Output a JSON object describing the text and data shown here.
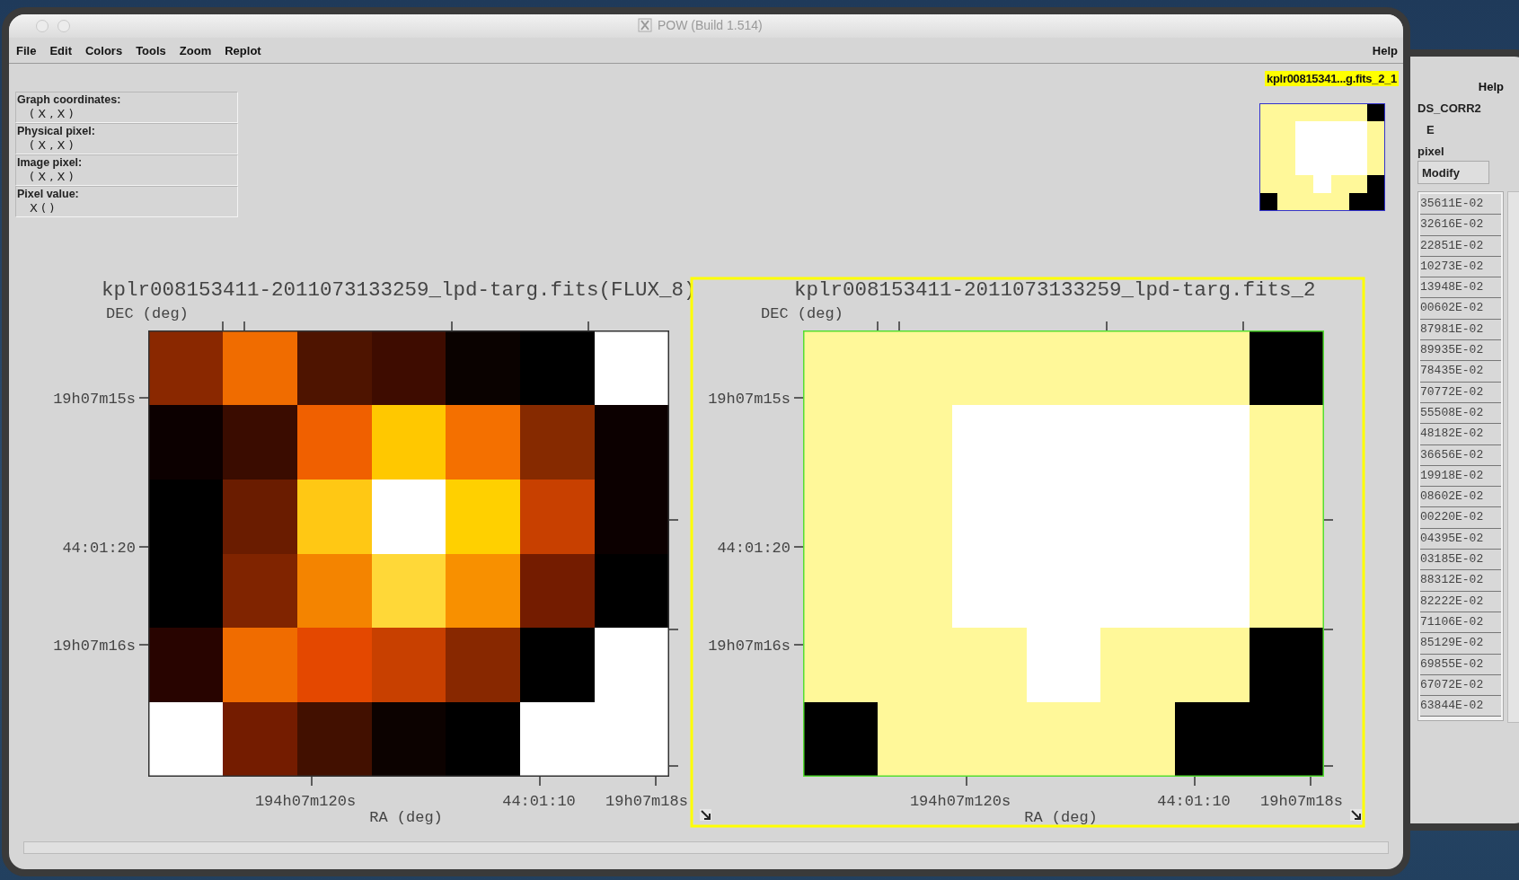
{
  "window": {
    "title": "POW (Build 1.514)"
  },
  "menu": [
    {
      "label": "File"
    },
    {
      "label": "Edit"
    },
    {
      "label": "Colors"
    },
    {
      "label": "Tools"
    },
    {
      "label": "Zoom"
    },
    {
      "label": "Replot"
    }
  ],
  "help_menu": "Help",
  "info_panel": [
    {
      "label": "Graph coordinates:",
      "value": "( X , X )"
    },
    {
      "label": "Physical pixel:",
      "value": "( X , X )"
    },
    {
      "label": "Image pixel:",
      "value": "( X , X )"
    },
    {
      "label": "Pixel value:",
      "value": "X ( )"
    }
  ],
  "current_graph_label": "kplr00815341...g.fits_2_1",
  "thumbnail": {
    "pixels": [
      [
        {
          "color": "#fff899"
        },
        {
          "color": "#fff899"
        },
        {
          "color": "#fff899"
        },
        {
          "color": "#fff899"
        },
        {
          "color": "#fff899"
        },
        {
          "color": "#fff899"
        },
        {
          "color": "#000000"
        }
      ],
      [
        {
          "color": "#fff899"
        },
        {
          "color": "#fff899"
        },
        {
          "color": "#ffffff"
        },
        {
          "color": "#ffffff"
        },
        {
          "color": "#ffffff"
        },
        {
          "color": "#ffffff"
        },
        {
          "color": "#fff899"
        }
      ],
      [
        {
          "color": "#fff899"
        },
        {
          "color": "#fff899"
        },
        {
          "color": "#ffffff"
        },
        {
          "color": "#ffffff"
        },
        {
          "color": "#ffffff"
        },
        {
          "color": "#ffffff"
        },
        {
          "color": "#fff899"
        }
      ],
      [
        {
          "color": "#fff899"
        },
        {
          "color": "#fff899"
        },
        {
          "color": "#ffffff"
        },
        {
          "color": "#ffffff"
        },
        {
          "color": "#ffffff"
        },
        {
          "color": "#ffffff"
        },
        {
          "color": "#fff899"
        }
      ],
      [
        {
          "color": "#fff899"
        },
        {
          "color": "#fff899"
        },
        {
          "color": "#fff899"
        },
        {
          "color": "#ffffff"
        },
        {
          "color": "#fff899"
        },
        {
          "color": "#fff899"
        },
        {
          "color": "#000000"
        }
      ],
      [
        {
          "color": "#000000"
        },
        {
          "color": "#fff899"
        },
        {
          "color": "#fff899"
        },
        {
          "color": "#fff899"
        },
        {
          "color": "#fff899"
        },
        {
          "color": "#000000"
        },
        {
          "color": "#000000"
        }
      ]
    ]
  },
  "plots": [
    {
      "title": "kplr008153411-2011073133259_lpd-targ.fits(FLUX_8)",
      "selected": false,
      "y_axis_label": "DEC (deg)",
      "x_axis_label": "RA (deg)",
      "y_ticks": [
        "19h07m15s",
        "44:01:20",
        "19h07m16s"
      ],
      "x_ticks": [
        "194h07m120s",
        "44:01:10",
        "19h07m18s"
      ],
      "pixels": [
        [
          {
            "color": "#8a2800"
          },
          {
            "color": "#f06c00"
          },
          {
            "color": "#4e1400"
          },
          {
            "color": "#3e0c00"
          },
          {
            "color": "#0a0200"
          },
          {
            "color": "#000000"
          },
          {
            "color": "#ffffff"
          }
        ],
        [
          {
            "color": "#0c0000"
          },
          {
            "color": "#3a0c00"
          },
          {
            "color": "#f06000"
          },
          {
            "color": "#ffc800"
          },
          {
            "color": "#f47000"
          },
          {
            "color": "#862a00"
          },
          {
            "color": "#0c0000"
          }
        ],
        [
          {
            "color": "#000000"
          },
          {
            "color": "#6a1c00"
          },
          {
            "color": "#ffc814"
          },
          {
            "color": "#ffffff"
          },
          {
            "color": "#ffd000"
          },
          {
            "color": "#c84000"
          },
          {
            "color": "#0c0000"
          }
        ],
        [
          {
            "color": "#000000"
          },
          {
            "color": "#802400"
          },
          {
            "color": "#f48400"
          },
          {
            "color": "#ffd838"
          },
          {
            "color": "#f89000"
          },
          {
            "color": "#741c00"
          },
          {
            "color": "#000000"
          }
        ],
        [
          {
            "color": "#280400"
          },
          {
            "color": "#f06c00"
          },
          {
            "color": "#e44800"
          },
          {
            "color": "#c84000"
          },
          {
            "color": "#882800"
          },
          {
            "color": "#000000"
          },
          {
            "color": "#ffffff"
          }
        ],
        [
          {
            "color": "#ffffff"
          },
          {
            "color": "#741c00"
          },
          {
            "color": "#421000"
          },
          {
            "color": "#0c0200"
          },
          {
            "color": "#000000"
          },
          {
            "color": "#ffffff"
          },
          {
            "color": "#ffffff"
          }
        ]
      ]
    },
    {
      "title": "kplr008153411-2011073133259_lpd-targ.fits_2",
      "selected": true,
      "y_axis_label": "DEC (deg)",
      "x_axis_label": "RA (deg)",
      "y_ticks": [
        "19h07m15s",
        "44:01:20",
        "19h07m16s"
      ],
      "x_ticks": [
        "194h07m120s",
        "44:01:10",
        "19h07m18s"
      ],
      "pixels": [
        [
          {
            "color": "#fff899"
          },
          {
            "color": "#fff899"
          },
          {
            "color": "#fff899"
          },
          {
            "color": "#fff899"
          },
          {
            "color": "#fff899"
          },
          {
            "color": "#fff899"
          },
          {
            "color": "#000000"
          }
        ],
        [
          {
            "color": "#fff899"
          },
          {
            "color": "#fff899"
          },
          {
            "color": "#ffffff"
          },
          {
            "color": "#ffffff"
          },
          {
            "color": "#ffffff"
          },
          {
            "color": "#ffffff"
          },
          {
            "color": "#fff899"
          }
        ],
        [
          {
            "color": "#fff899"
          },
          {
            "color": "#fff899"
          },
          {
            "color": "#ffffff"
          },
          {
            "color": "#ffffff"
          },
          {
            "color": "#ffffff"
          },
          {
            "color": "#ffffff"
          },
          {
            "color": "#fff899"
          }
        ],
        [
          {
            "color": "#fff899"
          },
          {
            "color": "#fff899"
          },
          {
            "color": "#ffffff"
          },
          {
            "color": "#ffffff"
          },
          {
            "color": "#ffffff"
          },
          {
            "color": "#ffffff"
          },
          {
            "color": "#fff899"
          }
        ],
        [
          {
            "color": "#fff899"
          },
          {
            "color": "#fff899"
          },
          {
            "color": "#fff899"
          },
          {
            "color": "#ffffff"
          },
          {
            "color": "#fff899"
          },
          {
            "color": "#fff899"
          },
          {
            "color": "#000000"
          }
        ],
        [
          {
            "color": "#000000"
          },
          {
            "color": "#fff899"
          },
          {
            "color": "#fff899"
          },
          {
            "color": "#fff899"
          },
          {
            "color": "#fff899"
          },
          {
            "color": "#000000"
          },
          {
            "color": "#000000"
          }
        ]
      ]
    }
  ],
  "back_window": {
    "help_menu": "Help",
    "column_name": "DS_CORR2",
    "line_2": "E",
    "line_3": "pixel",
    "button": "Modify",
    "values": [
      "35611E-02",
      "32616E-02",
      "22851E-02",
      "10273E-02",
      "13948E-02",
      "00602E-02",
      "87981E-02",
      "89935E-02",
      "78435E-02",
      "70772E-02",
      "55508E-02",
      "48182E-02",
      "36656E-02",
      "19918E-02",
      "08602E-02",
      "00220E-02",
      "04395E-02",
      "03185E-02",
      "88312E-02",
      "82222E-02",
      "71106E-02",
      "85129E-02",
      "69855E-02",
      "67072E-02",
      "63844E-02"
    ]
  }
}
